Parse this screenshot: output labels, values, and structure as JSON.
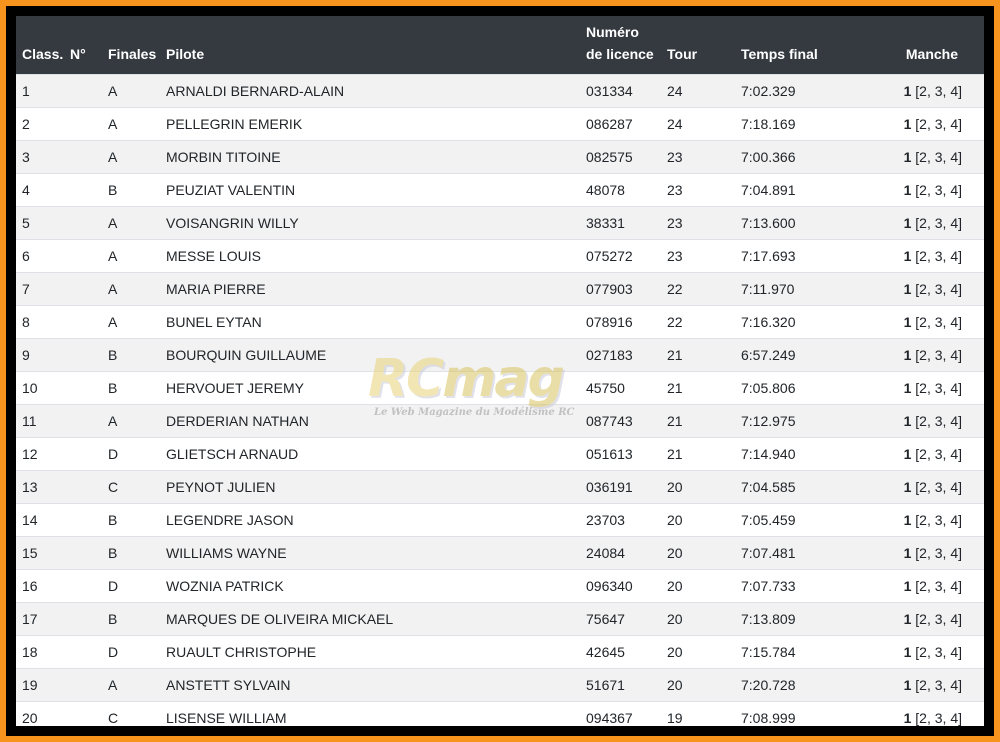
{
  "table": {
    "headers": {
      "class": "Class.",
      "num": "N°",
      "finales": "Finales",
      "pilote": "Pilote",
      "licence_line1": "Numéro",
      "licence_line2": "de licence",
      "tour": "Tour",
      "temps": "Temps final",
      "manche": "Manche"
    },
    "rows": [
      {
        "class": "1",
        "num": "",
        "finale": "A",
        "pilote": "ARNALDI BERNARD-ALAIN",
        "licence": "031334",
        "tour": "24",
        "temps": "7:02.329",
        "manche_best": "1",
        "manche_list": "[2, 3, 4]"
      },
      {
        "class": "2",
        "num": "",
        "finale": "A",
        "pilote": "PELLEGRIN EMERIK",
        "licence": "086287",
        "tour": "24",
        "temps": "7:18.169",
        "manche_best": "1",
        "manche_list": "[2, 3, 4]"
      },
      {
        "class": "3",
        "num": "",
        "finale": "A",
        "pilote": "MORBIN TITOINE",
        "licence": "082575",
        "tour": "23",
        "temps": "7:00.366",
        "manche_best": "1",
        "manche_list": "[2, 3, 4]"
      },
      {
        "class": "4",
        "num": "",
        "finale": "B",
        "pilote": "PEUZIAT VALENTIN",
        "licence": "48078",
        "tour": "23",
        "temps": "7:04.891",
        "manche_best": "1",
        "manche_list": "[2, 3, 4]"
      },
      {
        "class": "5",
        "num": "",
        "finale": "A",
        "pilote": "VOISANGRIN WILLY",
        "licence": "38331",
        "tour": "23",
        "temps": "7:13.600",
        "manche_best": "1",
        "manche_list": "[2, 3, 4]"
      },
      {
        "class": "6",
        "num": "",
        "finale": "A",
        "pilote": "MESSE LOUIS",
        "licence": "075272",
        "tour": "23",
        "temps": "7:17.693",
        "manche_best": "1",
        "manche_list": "[2, 3, 4]"
      },
      {
        "class": "7",
        "num": "",
        "finale": "A",
        "pilote": "MARIA PIERRE",
        "licence": "077903",
        "tour": "22",
        "temps": "7:11.970",
        "manche_best": "1",
        "manche_list": "[2, 3, 4]"
      },
      {
        "class": "8",
        "num": "",
        "finale": "A",
        "pilote": "BUNEL EYTAN",
        "licence": "078916",
        "tour": "22",
        "temps": "7:16.320",
        "manche_best": "1",
        "manche_list": "[2, 3, 4]"
      },
      {
        "class": "9",
        "num": "",
        "finale": "B",
        "pilote": "BOURQUIN GUILLAUME",
        "licence": "027183",
        "tour": "21",
        "temps": "6:57.249",
        "manche_best": "1",
        "manche_list": "[2, 3, 4]"
      },
      {
        "class": "10",
        "num": "",
        "finale": "B",
        "pilote": "HERVOUET JEREMY",
        "licence": "45750",
        "tour": "21",
        "temps": "7:05.806",
        "manche_best": "1",
        "manche_list": "[2, 3, 4]"
      },
      {
        "class": "11",
        "num": "",
        "finale": "A",
        "pilote": "DERDERIAN NATHAN",
        "licence": "087743",
        "tour": "21",
        "temps": "7:12.975",
        "manche_best": "1",
        "manche_list": "[2, 3, 4]"
      },
      {
        "class": "12",
        "num": "",
        "finale": "D",
        "pilote": "GLIETSCH ARNAUD",
        "licence": "051613",
        "tour": "21",
        "temps": "7:14.940",
        "manche_best": "1",
        "manche_list": "[2, 3, 4]"
      },
      {
        "class": "13",
        "num": "",
        "finale": "C",
        "pilote": "PEYNOT JULIEN",
        "licence": "036191",
        "tour": "20",
        "temps": "7:04.585",
        "manche_best": "1",
        "manche_list": "[2, 3, 4]"
      },
      {
        "class": "14",
        "num": "",
        "finale": "B",
        "pilote": "LEGENDRE JASON",
        "licence": "23703",
        "tour": "20",
        "temps": "7:05.459",
        "manche_best": "1",
        "manche_list": "[2, 3, 4]"
      },
      {
        "class": "15",
        "num": "",
        "finale": "B",
        "pilote": "WILLIAMS WAYNE",
        "licence": "24084",
        "tour": "20",
        "temps": "7:07.481",
        "manche_best": "1",
        "manche_list": "[2, 3, 4]"
      },
      {
        "class": "16",
        "num": "",
        "finale": "D",
        "pilote": "WOZNIA PATRICK",
        "licence": "096340",
        "tour": "20",
        "temps": "7:07.733",
        "manche_best": "1",
        "manche_list": "[2, 3, 4]"
      },
      {
        "class": "17",
        "num": "",
        "finale": "B",
        "pilote": "MARQUES DE OLIVEIRA MICKAEL",
        "licence": "75647",
        "tour": "20",
        "temps": "7:13.809",
        "manche_best": "1",
        "manche_list": "[2, 3, 4]"
      },
      {
        "class": "18",
        "num": "",
        "finale": "D",
        "pilote": "RUAULT CHRISTOPHE",
        "licence": "42645",
        "tour": "20",
        "temps": "7:15.784",
        "manche_best": "1",
        "manche_list": "[2, 3, 4]"
      },
      {
        "class": "19",
        "num": "",
        "finale": "A",
        "pilote": "ANSTETT SYLVAIN",
        "licence": "51671",
        "tour": "20",
        "temps": "7:20.728",
        "manche_best": "1",
        "manche_list": "[2, 3, 4]"
      },
      {
        "class": "20",
        "num": "",
        "finale": "C",
        "pilote": "LISENSE WILLIAM",
        "licence": "094367",
        "tour": "19",
        "temps": "7:08.999",
        "manche_best": "1",
        "manche_list": "[2, 3, 4]"
      }
    ]
  },
  "watermark": {
    "logo": "RCmag",
    "tagline": "Le Web Magazine du Modélisme RC"
  },
  "colors": {
    "border_outer": "#f7941d",
    "border_inner": "#000000",
    "header_bg": "#343a40",
    "stripe": "#f2f2f2"
  }
}
